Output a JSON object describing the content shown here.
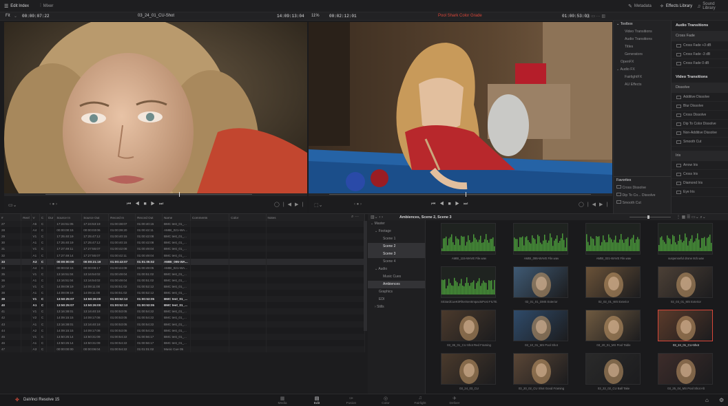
{
  "topbar": {
    "edit_index": "Edit Index",
    "mixer": "Mixer",
    "metadata": "Metadata",
    "effects_library": "Effects Library",
    "sound_library": "Sound Library"
  },
  "viewer_bar": {
    "fit": "Fit",
    "source_tc": "00:00:07:22",
    "clip_name": "03_24_01_CU-Shot",
    "source_dur": "14:09:13:04",
    "zoom": "11%",
    "timeline_tc": "00:02:12:01",
    "timeline_name": "Pool Shark Color Grade",
    "record_tc": "01:00:53:03"
  },
  "effects_tree": {
    "toolbox": "Toolbox",
    "items": [
      "Video Transitions",
      "Audio Transitions",
      "Titles",
      "Generators",
      "OpenFX",
      "Audio FX",
      "FairlightFX",
      "AU Effects"
    ],
    "favorites_label": "Favorites",
    "favorites": [
      "Cross Dissolve",
      "Dip To Co... Dissolve",
      "Smooth Cut"
    ]
  },
  "effects_list": {
    "audio_transitions": "Audio Transitions",
    "cross_fade": "Cross Fade",
    "audio_items": [
      "Cross Fade +3 dB",
      "Cross Fade -3 dB",
      "Cross Fade 0 dB"
    ],
    "video_transitions": "Video Transitions",
    "dissolve": "Dissolve",
    "video_items": [
      "Additive Dissolve",
      "Blur Dissolve",
      "Cross Dissolve",
      "Dip To Color Dissolve",
      "Non-Additive Dissolve",
      "Smooth Cut"
    ],
    "iris": "Iris",
    "iris_items": [
      "Arrow Iris",
      "Cross Iris",
      "Diamond Iris",
      "Eye Iris"
    ]
  },
  "edit_index": {
    "columns": [
      "#",
      "Reel",
      "V",
      "C",
      "Dur",
      "Source In",
      "Source Out",
      "Record In",
      "Record Out",
      "Name",
      "Comments",
      "Color",
      "Notes"
    ],
    "rows": [
      [
        "27",
        "",
        "A5",
        "C",
        "",
        "17:24:51:05",
        "17:24:53:19",
        "01:00:38:07",
        "01:00:40:15",
        "BMC test_01_..."
      ],
      [
        "28",
        "",
        "A4",
        "C",
        "",
        "00:00:00:15",
        "00:00:03:06",
        "01:00:39:20",
        "01:00:42:11",
        "AMBI_021-WA..."
      ],
      [
        "29",
        "",
        "V1",
        "C",
        "",
        "17:25:40:19",
        "17:25:47:12",
        "01:00:40:15",
        "01:00:42:08",
        "BMC test_01_..."
      ],
      [
        "30",
        "",
        "A1",
        "C",
        "",
        "17:25:40:19",
        "17:25:47:12",
        "01:00:40:15",
        "01:00:42:08",
        "BMC test_01_..."
      ],
      [
        "31",
        "",
        "V1",
        "C",
        "",
        "17:27:49:11",
        "17:27:55:07",
        "01:00:42:08",
        "01:00:49:04",
        "BMC test_01_..."
      ],
      [
        "32",
        "",
        "A1",
        "C",
        "",
        "17:27:49:14",
        "17:27:55:07",
        "01:00:42:11",
        "01:00:49:04",
        "BMC test_01_..."
      ],
      [
        "33",
        "",
        "A3",
        "C",
        "",
        "00:00:00:00",
        "00:00:21:19",
        "01:00:43:07",
        "01:01:05:02",
        "AMBI_095-WA..."
      ],
      [
        "34",
        "",
        "A4",
        "C",
        "",
        "00:00:02:15",
        "00:00:08:17",
        "01:00:44:08",
        "01:00:49:05",
        "AMBI_021-WA..."
      ],
      [
        "35",
        "",
        "V1",
        "C",
        "",
        "13:16:51:04",
        "13:16:54:02",
        "01:00:49:04",
        "01:00:51:02",
        "BMC test_01_..."
      ],
      [
        "36",
        "",
        "A1",
        "C",
        "",
        "13:16:51:04",
        "13:16:54:02",
        "01:00:49:04",
        "01:00:51:02",
        "BMC test_01_..."
      ],
      [
        "37",
        "",
        "V1",
        "C",
        "",
        "14:09:09:19",
        "14:09:11:00",
        "01:00:51:02",
        "01:00:52:12",
        "BMC test_01_..."
      ],
      [
        "38",
        "",
        "A1",
        "C",
        "",
        "14:09:09:19",
        "14:09:11:00",
        "01:00:51:02",
        "01:00:52:12",
        "BMC test_01_..."
      ],
      [
        "39",
        "",
        "V1",
        "C",
        "",
        "13:50:25:07",
        "13:50:26:00",
        "01:00:52:13",
        "01:00:53:05",
        "BMC test_01_..."
      ],
      [
        "40",
        "",
        "A1",
        "C",
        "",
        "13:50:25:07",
        "13:50:26:00",
        "01:00:52:13",
        "01:00:53:05",
        "BMC test_01_..."
      ],
      [
        "41",
        "",
        "V1",
        "C",
        "",
        "13:16:38:01",
        "13:16:40:18",
        "01:00:53:05",
        "01:00:54:22",
        "BMC test_01_..."
      ],
      [
        "42",
        "",
        "V2",
        "C",
        "",
        "14:09:15:15",
        "14:09:17:08",
        "01:00:53:05",
        "01:00:54:22",
        "BMC test_01_..."
      ],
      [
        "43",
        "",
        "A1",
        "C",
        "",
        "13:16:38:01",
        "13:16:40:18",
        "01:00:53:05",
        "01:00:54:22",
        "BMC test_01_..."
      ],
      [
        "44",
        "",
        "A2",
        "C",
        "",
        "14:09:15:15",
        "14:09:17:08",
        "01:00:53:05",
        "01:00:54:22",
        "BMC test_01_..."
      ],
      [
        "45",
        "",
        "V1",
        "C",
        "",
        "13:50:25:14",
        "13:50:31:09",
        "01:00:54:22",
        "01:00:56:17",
        "BMC test_01_..."
      ],
      [
        "46",
        "",
        "A1",
        "C",
        "",
        "13:50:25:14",
        "13:50:31:09",
        "01:00:54:22",
        "01:00:56:17",
        "BMC test_01_..."
      ],
      [
        "47",
        "",
        "A3",
        "C",
        "",
        "00:00:00:00",
        "00:00:06:04",
        "01:00:54:22",
        "01:01:01:02",
        "Music Cue 05"
      ]
    ]
  },
  "media_pool": {
    "path": "Ambiences, Scene 2, Scene 3",
    "bins": [
      "Master",
      "Footage",
      "Scene 1",
      "Scene 2",
      "Scene 3",
      "Scene 4",
      "Audio",
      "Music Cues",
      "Ambiences",
      "Graphics",
      "EDI",
      "Stills"
    ],
    "clips": [
      "AMBI_115-WAVE File.wav",
      "AMBI_095-WAVE File.wav",
      "AMBI_021-WAVE File.wav",
      "suspenseful drone 8ch.wav",
      "S03ardCueKitFilterSentImpactsPost FILTE...",
      "02_01_01_DMS Exterior",
      "02_02_01_WS Exterior",
      "02_03_01_MS Exterior",
      "03_35_01_CU Shot Red Framing",
      "03_10_01_MS Pool Shot",
      "03_20_01_MS Pool Table",
      "03_24_01_CU-Shot",
      "03_24_03_CU",
      "03_20_02_CU Shot Good Framing",
      "03_22_02_CU Ball Take",
      "03_25_04_MS Pool Shot Alt"
    ]
  },
  "bottombar": {
    "app_name": "DaVinci Resolve 15",
    "pages": [
      "Media",
      "Edit",
      "Fusion",
      "Color",
      "Fairlight",
      "Deliver"
    ]
  },
  "colors": {
    "accent_red": "#d9473a",
    "panel_bg": "#1c1c1e"
  }
}
